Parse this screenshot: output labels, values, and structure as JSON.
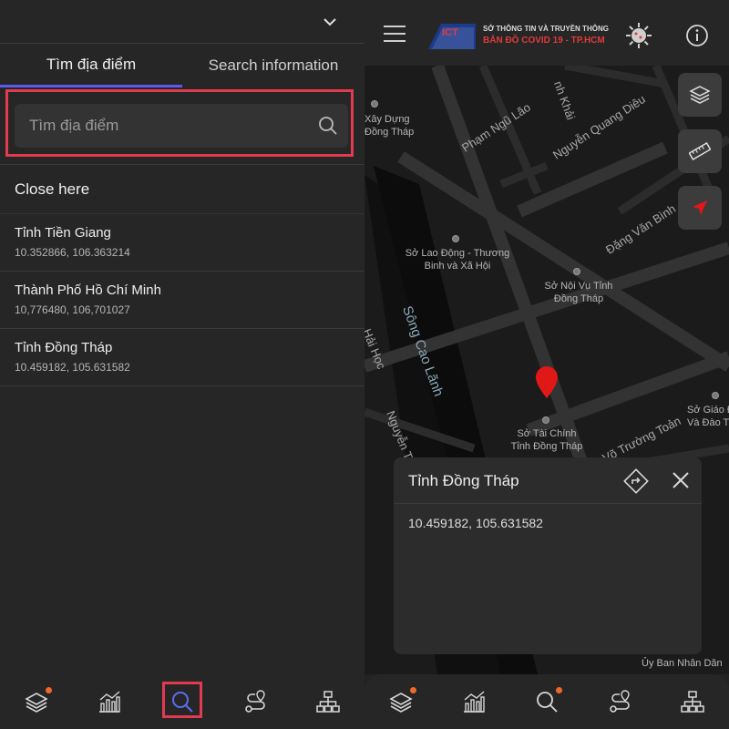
{
  "left_panel": {
    "tabs": [
      {
        "label": "Tìm địa điểm",
        "active": true
      },
      {
        "label": "Search information",
        "active": false
      }
    ],
    "search": {
      "placeholder": "Tìm địa điểm",
      "value": ""
    },
    "close_here_label": "Close here",
    "locations": [
      {
        "name": "Tỉnh Tiền Giang",
        "coords": "10.352866, 106.363214"
      },
      {
        "name": "Thành Phố Hồ Chí Minh",
        "coords": "10,776480, 106,701027"
      },
      {
        "name": "Tỉnh Đồng Tháp",
        "coords": "10.459182, 105.631582"
      }
    ],
    "bottom_nav": [
      {
        "icon": "layers-icon",
        "badge": true
      },
      {
        "icon": "chart-icon",
        "badge": false
      },
      {
        "icon": "search-icon",
        "badge": false,
        "highlighted": true
      },
      {
        "icon": "route-icon",
        "badge": false
      },
      {
        "icon": "sitemap-icon",
        "badge": false
      }
    ]
  },
  "right_panel": {
    "logo": {
      "badge_text": "ICT",
      "line1": "SỞ THÔNG TIN VÀ TRUYỀN THÔNG",
      "line2": "BẢN ĐỒ COVID 19 - TP.HCM"
    },
    "map_labels": {
      "poi_1": "Xây Dựng\nĐồng Tháp",
      "poi_2": "Sở Lao Động - Thương\nBinh và Xã Hội",
      "poi_3": "Sở Nội Vụ Tỉnh\nĐồng Tháp",
      "poi_4": "Sở Tài Chính\nTỉnh Đồng Tháp",
      "poi_5": "Sở Giáo Đ\nVà Đào T",
      "poi_6": "Ủy Ban Nhân Dân"
    },
    "streets": {
      "s1": "Phạm Ngũ Lão",
      "s2": "Nguyễn Quang Diêu",
      "s3": "Đặng Văn Bình",
      "s4": "Võ Trường Toản",
      "s5": "Nguyễn Thị",
      "s6": "Hải Học",
      "s7": "nh Khải",
      "river": "Sông Cao Lãnh"
    },
    "popup": {
      "title": "Tỉnh Đồng Tháp",
      "coords": "10.459182, 105.631582"
    },
    "colors": {
      "accent": "#5a5af0",
      "highlight": "#e23a4f",
      "pin": "#e01818",
      "badge": "#f0672a"
    }
  }
}
